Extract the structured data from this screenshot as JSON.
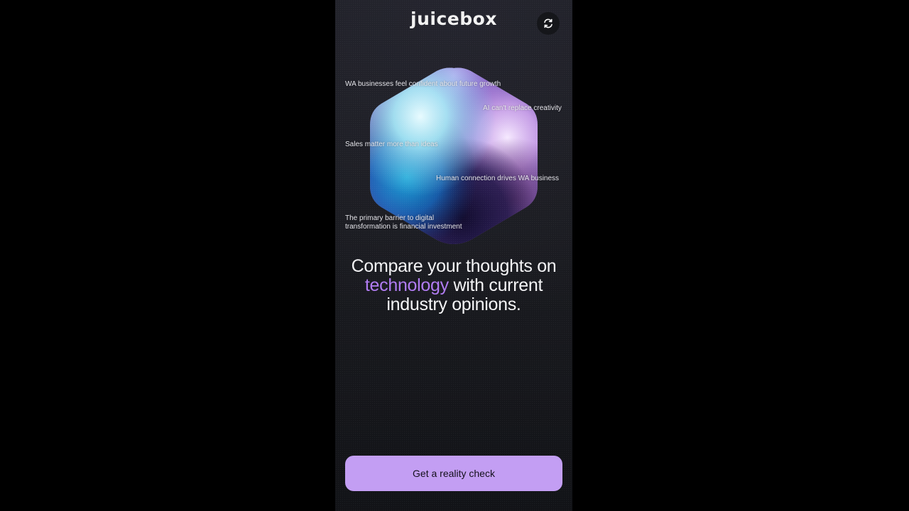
{
  "header": {
    "logo_text": "juicebox",
    "refresh_icon": "refresh-icon"
  },
  "opinions": [
    "WA businesses feel confident about future growth",
    "AI can't replace creativity",
    "Sales matter more than ideas",
    "Human connection drives WA business",
    "The primary barrier to digital",
    "transformation is financial investment"
  ],
  "headline": {
    "line1": "Compare your thoughts on",
    "accent_word": "technology",
    "line2_rest": " with current",
    "line3": "industry opinions."
  },
  "cta": {
    "label": "Get a reality check"
  },
  "colors": {
    "accent": "#b17cf2",
    "button_bg": "#c39ef3",
    "background": "#1c1d22"
  }
}
